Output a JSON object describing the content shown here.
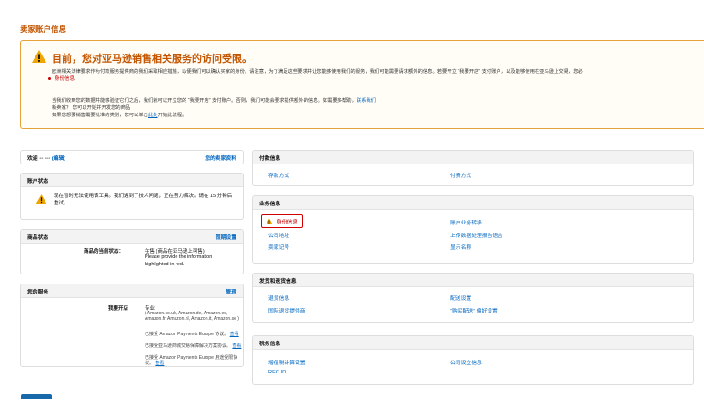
{
  "page": {
    "title": "卖家账户信息"
  },
  "alert": {
    "title": "目前，您对亚马逊销售相关服务的访问受限。",
    "description": "欧洲相关法律要求作为付款服务提供商的我们采取相应措施，以便我们可以确认买家的身份。请注意，为了满足这些要求并让您能够使用我们的服务，我们可能需要请求额外的信息。若要开立 “我要开店” 支付账户，以及能够使用在亚马逊上交易，您必",
    "bullet": "身份信息",
    "p1_text": "当我们收到您的数据并能够验证它们之后，我们就可以开立您的 “我要开店” 支付账户。否则，我们可能会要求提供额外的信息。如需要多帮助，",
    "p1_link": "联系我们",
    "p2": "新卖家？ 您可以开始并开发您的商品",
    "p3_text": "如果您想要销售需要批准的类别，您可以单击",
    "p3_link": "此处",
    "p3_tail": "开始此流程。"
  },
  "welcome": {
    "prefix": "欢迎",
    "name": "▪▪ ▪▪▪",
    "edit": "(编辑)",
    "link": "您的卖家资料"
  },
  "account_status": {
    "title": "账户状态",
    "message": "现在暂时无法使用该工具。我们遇到了技术问题，正在努力解决。请在 15 分钟后重试。"
  },
  "listing_status": {
    "title": "商品状态",
    "link": "假期设置",
    "label": "商品的当前状态：",
    "value1": "在售 (商品在亚马逊上可售)",
    "value2": "Please provide the information",
    "value3": "highlighted in red."
  },
  "services": {
    "title": "您的服务",
    "link": "管理",
    "label": "我要开店",
    "plan": "专业",
    "marketplaces": "( Amazon.co.uk, Amazon.de, Amazon.es, Amazon.fr, Amazon.nl, Amazon.it, Amazon.se )",
    "line1_text": "已接受 Amazon Payments Europe 协议。",
    "line1_link": "查看",
    "line2_text": "已接受亚马逊商城交易保障解决方案协议。",
    "line2_link": "查看",
    "line3_text": "已接受 Amazon Payments Europe 用途受限协议。",
    "line3_link": "查看"
  },
  "payment": {
    "title": "付款信息",
    "deposit": "存款方式",
    "charge": "付费方式"
  },
  "business": {
    "title": "业务信息",
    "identity": "身份信息",
    "transfer": "账户业务转移",
    "address": "公司地址",
    "upload_lang": "上传数据处理报告语言",
    "seller_token": "卖家记号",
    "display_name": "显示名称"
  },
  "shipping": {
    "title": "发货和退货信息",
    "returns": "退货信息",
    "shipping_settings": "配送设置",
    "intl_returns": "国际退货提供商",
    "buy_shipping": "“购买配送” 偏好设置"
  },
  "tax": {
    "title": "税务信息",
    "vat": "增值税计算设置",
    "company": "公司设立信息",
    "rfc": "RFC ID"
  },
  "colors": {
    "accent": "#c45500",
    "link": "#0066c0",
    "error": "#c40000",
    "warning": "#f0a500"
  }
}
